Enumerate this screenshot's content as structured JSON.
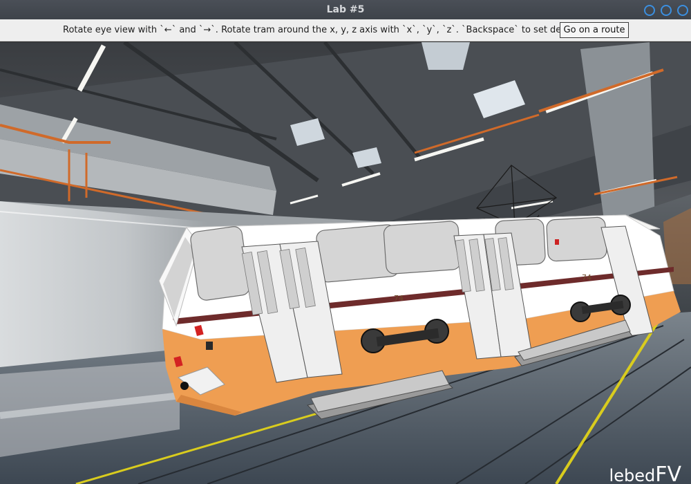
{
  "window": {
    "title": "Lab #5",
    "controls": [
      "minimize-icon",
      "maximize-icon",
      "close-icon"
    ],
    "control_color": "#3b8fe0"
  },
  "toolbar": {
    "hint_text": "Rotate eye view with `←` and `→`. Rotate tram around the x, y, z axis with `x`, `y`, `z`. `Backspace` to set default",
    "route_button_label": "Go on a route"
  },
  "scene": {
    "tram_color": "#ef9e52",
    "tram_number": "74",
    "floor_line_color": "#e0d020",
    "watermark_small": "lebed",
    "watermark_big": "FV"
  }
}
